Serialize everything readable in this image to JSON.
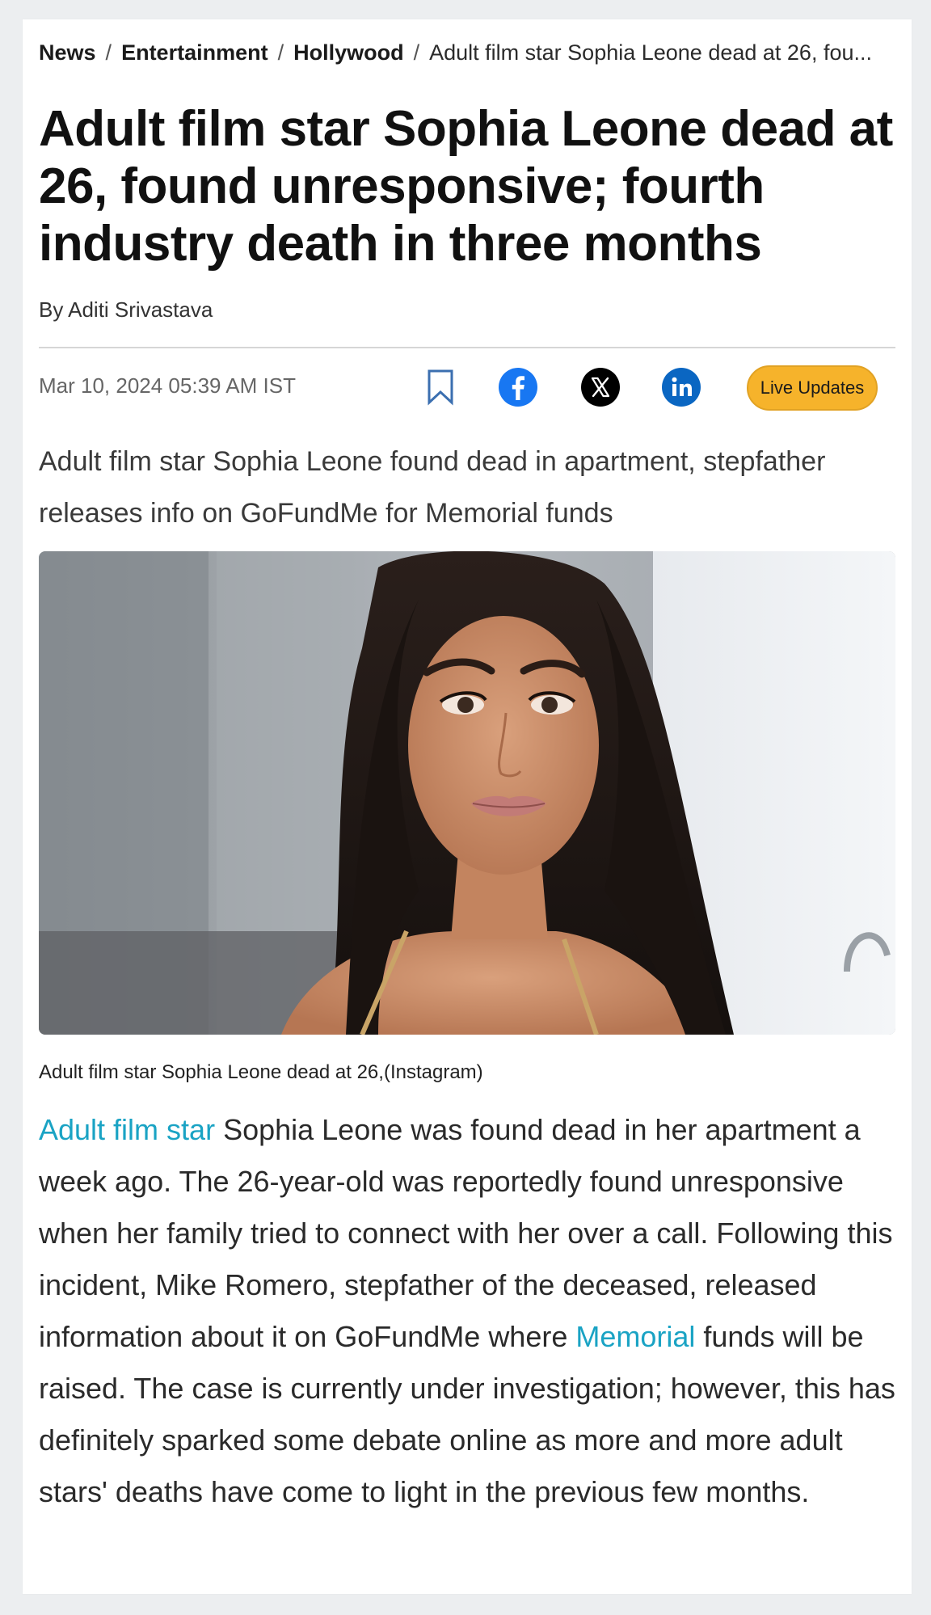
{
  "breadcrumb": {
    "items": [
      "News",
      "Entertainment",
      "Hollywood"
    ],
    "separator": "/",
    "current": "Adult film star Sophia Leone dead at 26, fou..."
  },
  "article": {
    "headline": "Adult film star Sophia Leone dead at 26, found unresponsive; fourth industry death in three months",
    "byline": "By Aditi Srivastava",
    "date": "Mar 10, 2024 05:39 AM IST",
    "summary": "Adult film star Sophia Leone found dead in apartment, stepfather releases info on GoFundMe for Memorial funds",
    "image_caption": "Adult film star Sophia Leone dead at 26,(Instagram)",
    "body": {
      "link1": "Adult film star",
      "part1": " Sophia Leone was found dead in her apartment a week ago. The 26-year-old was reportedly found unresponsive when her family tried to connect with her over a call. Following this incident, Mike Romero, stepfather of the deceased, released information about it on GoFundMe where ",
      "link2": "Memorial",
      "part2": " funds will be raised. The case is currently under investigation; however, this has definitely sparked some debate online as more and more adult stars' deaths have come to light in the previous few months."
    }
  },
  "share": {
    "icons": [
      "bookmark-icon",
      "facebook-icon",
      "x-icon",
      "linkedin-icon"
    ],
    "live_label": "Live Updates"
  },
  "colors": {
    "facebook": "#1877f2",
    "x": "#000000",
    "linkedin": "#0a66c2",
    "live_badge": "#f6b32b",
    "link": "#1aa3c4"
  }
}
